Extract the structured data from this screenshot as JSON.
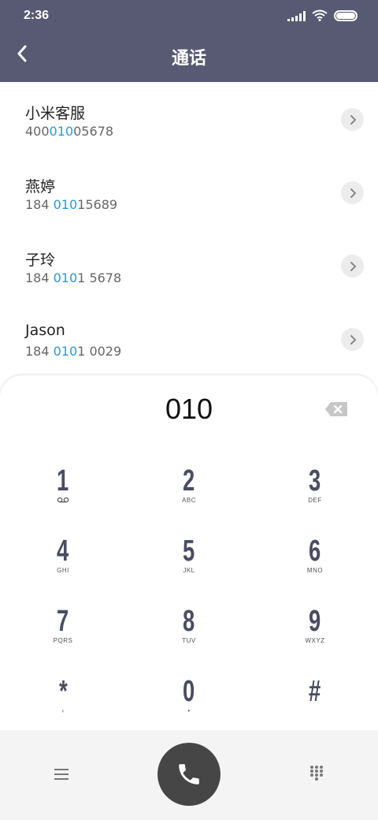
{
  "status_bar": {
    "time": "2:36",
    "icons": [
      "signal-icon",
      "wifi-icon",
      "battery-icon"
    ]
  },
  "header": {
    "title": "通话",
    "back_icon": "chevron-left-icon"
  },
  "colors": {
    "header_bg": "#585a73",
    "highlight": "#1e9be6",
    "key_text": "#4a4c63",
    "call_button": "#464646"
  },
  "contacts": [
    {
      "name": "小米客服",
      "number_pre": "400",
      "number_match": "010",
      "number_post": "05678"
    },
    {
      "name": "燕婷",
      "number_pre": "184 ",
      "number_match": "010",
      "number_post": "15689"
    },
    {
      "name": "子玲",
      "number_pre": "184 ",
      "number_match": "010",
      "number_post": "1 5678"
    },
    {
      "name": "Jason",
      "number_pre": "184 ",
      "number_match": "010",
      "number_post": "1 0029"
    }
  ],
  "dialpad": {
    "input": "010",
    "keys": [
      {
        "digit": "1",
        "sub": ""
      },
      {
        "digit": "2",
        "sub": "ABC"
      },
      {
        "digit": "3",
        "sub": "DEF"
      },
      {
        "digit": "4",
        "sub": "GHI"
      },
      {
        "digit": "5",
        "sub": "JKL"
      },
      {
        "digit": "6",
        "sub": "MNO"
      },
      {
        "digit": "7",
        "sub": "PQRS"
      },
      {
        "digit": "8",
        "sub": "TUV"
      },
      {
        "digit": "9",
        "sub": "WXYZ"
      },
      {
        "digit": "*",
        "sub": ","
      },
      {
        "digit": "0",
        "sub": "•"
      },
      {
        "digit": "#",
        "sub": ""
      }
    ]
  },
  "bottom_bar": {
    "left_icon": "menu-icon",
    "center_icon": "phone-icon",
    "right_icon": "dialpad-grid-icon"
  }
}
